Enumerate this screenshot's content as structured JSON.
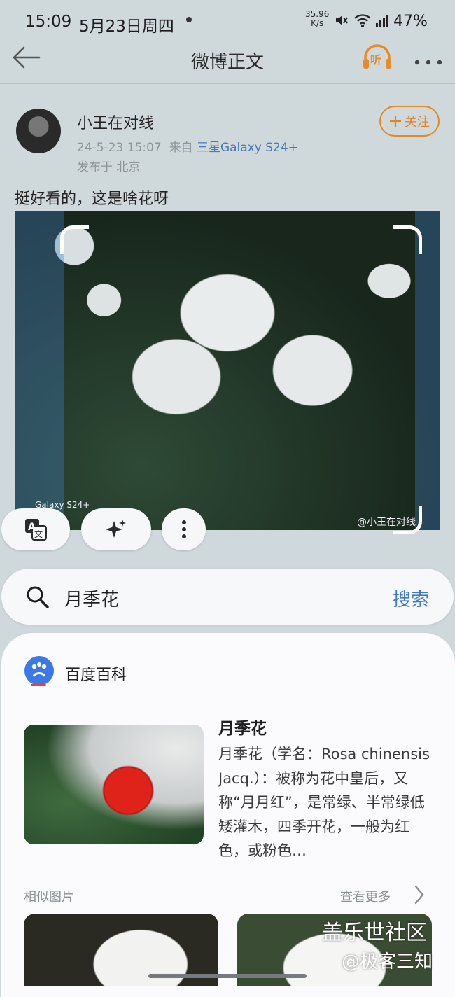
{
  "status_bar": {
    "time": "15:09",
    "date": "5月23日周四",
    "net_speed_value": "35.96",
    "net_speed_unit": "K/s",
    "battery": "47%"
  },
  "nav": {
    "title": "微博正文",
    "listen_label": "听"
  },
  "post": {
    "username": "小王在对线",
    "timestamp": "24-5-23 15:07",
    "source_prefix": "来自",
    "device": "三星Galaxy S24+",
    "location": "发布于 北京",
    "follow_label": "关注",
    "text": "挺好看的，这是啥花呀",
    "photo_watermark_left": "Galaxy S24+",
    "photo_watermark_right": "@小王在对线"
  },
  "search": {
    "query": "月季花",
    "button_label": "搜索"
  },
  "result": {
    "source_name": "百度百科",
    "title": "月季花",
    "description": "月季花（学名：Rosa chinensis Jacq.）：被称为花中皇后，又称“月月红”，是常绿、半常绿低矮灌木，四季开花，一般为红色，或粉色…",
    "similar_label": "相似图片",
    "more_label": "查看更多"
  },
  "overlay_watermark": {
    "line1": "盖乐世社区",
    "line2": "@极客三知"
  },
  "colors": {
    "accent_orange": "#e0832a",
    "link_blue": "#3f78c8"
  }
}
